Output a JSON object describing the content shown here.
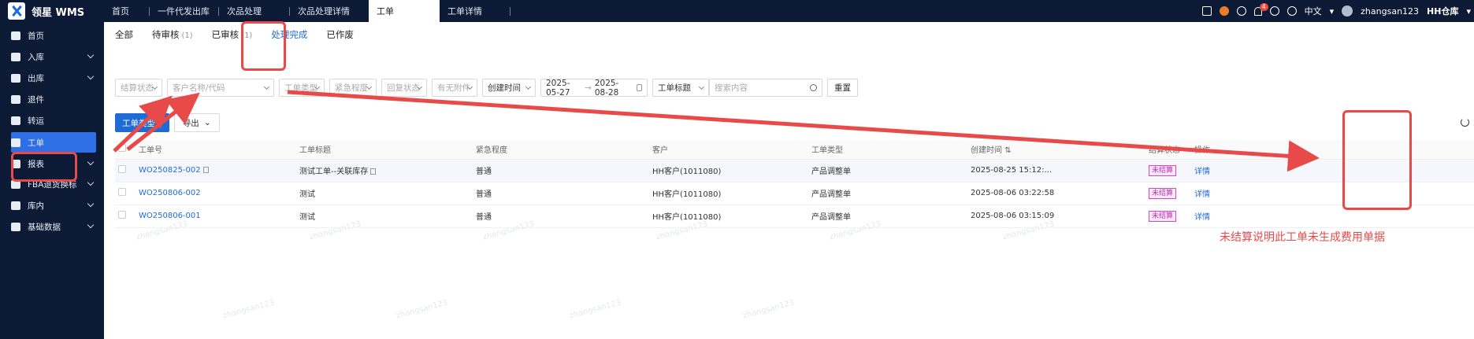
{
  "app": {
    "title": "领星 WMS"
  },
  "tabs": [
    "首页",
    "一件代发出库",
    "次品处理",
    "次品处理详情",
    "工单",
    "工单详情"
  ],
  "active_tab_index": 4,
  "header": {
    "notification_count": "4",
    "language": "中文",
    "username": "zhangsan123",
    "warehouse": "HH仓库"
  },
  "sidebar": {
    "items": [
      {
        "label": "首页",
        "icon": "home-icon"
      },
      {
        "label": "入库",
        "icon": "inbound-icon"
      },
      {
        "label": "出库",
        "icon": "outbound-icon"
      },
      {
        "label": "退件",
        "icon": "return-icon"
      },
      {
        "label": "转运",
        "icon": "transfer-icon"
      },
      {
        "label": "工单",
        "icon": "workorder-icon"
      },
      {
        "label": "报表",
        "icon": "report-icon"
      },
      {
        "label": "FBA退货换标",
        "icon": "fba-icon"
      },
      {
        "label": "库内",
        "icon": "warehouse-icon"
      },
      {
        "label": "基础数据",
        "icon": "data-icon"
      }
    ]
  },
  "subtabs": [
    {
      "label": "全部",
      "count": ""
    },
    {
      "label": "待审核",
      "count": "(1)"
    },
    {
      "label": "已审核",
      "count": "(1)"
    },
    {
      "label": "处理完成",
      "count": ""
    },
    {
      "label": "已作废",
      "count": ""
    }
  ],
  "filters": {
    "settlement_status": "结算状态",
    "customer": "客户名称/代码",
    "order_type": "工单类型",
    "urgency": "紧急程度",
    "reply_status": "回复状态",
    "attachment": "有无附件",
    "time_field": "创建时间",
    "date_start": "2025-05-27",
    "date_end": "2025-08-28",
    "search_field": "工单标题",
    "search_placeholder": "搜索内容",
    "reset": "重置"
  },
  "toolbar": {
    "add": "工单类型+",
    "export": "导出"
  },
  "table": {
    "headers": [
      "工单号",
      "工单标题",
      "紧急程度",
      "客户",
      "工单类型",
      "创建时间",
      "结算状态",
      "操作"
    ],
    "rows": [
      {
        "no": "WO250825-002",
        "title": "测试工单--关联库存",
        "urgency": "普通",
        "customer": "HH客户(1011080)",
        "type": "产品调整单",
        "time": "2025-08-25 15:12:...",
        "status": "未结算",
        "action": "详情"
      },
      {
        "no": "WO250806-002",
        "title": "测试",
        "urgency": "普通",
        "customer": "HH客户(1011080)",
        "type": "产品调整单",
        "time": "2025-08-06 03:22:58",
        "status": "未结算",
        "action": "详情"
      },
      {
        "no": "WO250806-001",
        "title": "测试",
        "urgency": "普通",
        "customer": "HH客户(1011080)",
        "type": "产品调整单",
        "time": "2025-08-06 03:15:09",
        "status": "未结算",
        "action": "详情"
      }
    ]
  },
  "annotation": "未结算说明此工单未生成费用单据",
  "watermark": "zhangsan123",
  "colors": {
    "sidebar_bg": "#0d1a35",
    "primary": "#1f6bd6",
    "annotation_red": "#e84a4a",
    "tag_purple": "#b53bb0"
  }
}
